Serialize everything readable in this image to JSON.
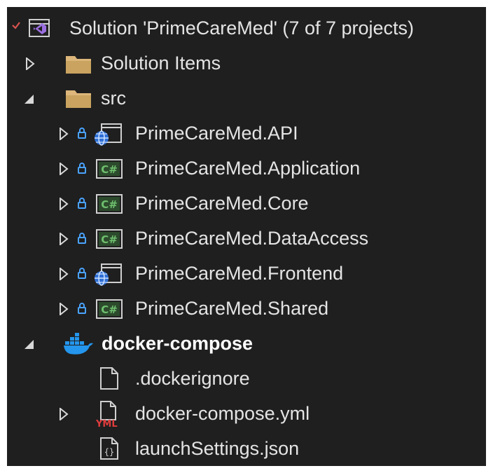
{
  "solution": {
    "title": "Solution 'PrimeCareMed' (7 of 7 projects)"
  },
  "tree": {
    "solution_items": "Solution Items",
    "src": "src",
    "projects": [
      {
        "label": "PrimeCareMed.API",
        "icon": "web-project-icon"
      },
      {
        "label": "PrimeCareMed.Application",
        "icon": "csharp-project-icon"
      },
      {
        "label": "PrimeCareMed.Core",
        "icon": "csharp-project-icon"
      },
      {
        "label": "PrimeCareMed.DataAccess",
        "icon": "csharp-project-icon"
      },
      {
        "label": "PrimeCareMed.Frontend",
        "icon": "web-project-icon"
      },
      {
        "label": "PrimeCareMed.Shared",
        "icon": "csharp-project-icon"
      }
    ],
    "docker_compose": "docker-compose",
    "files": [
      {
        "label": ".dockerignore",
        "icon": "file-icon"
      },
      {
        "label": "docker-compose.yml",
        "icon": "yml-file-icon",
        "badge": "YML"
      },
      {
        "label": "launchSettings.json",
        "icon": "json-file-icon"
      }
    ]
  },
  "colors": {
    "background": "#1f1f1f",
    "text": "#e4e4e4",
    "folder": "#dcb67a",
    "lock": "#4aa3ff",
    "csharp": "#6fc06f",
    "docker": "#2496ed",
    "yml_badge": "#e03c3c",
    "solution_check": "#d9534f",
    "vs_purple": "#9b6fe0"
  }
}
